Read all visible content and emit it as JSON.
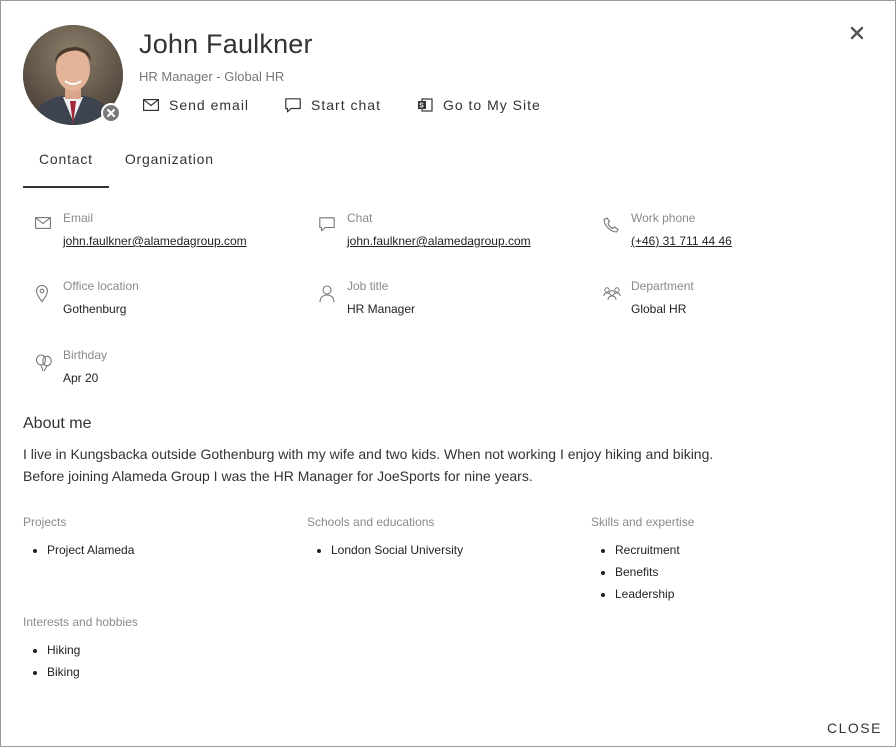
{
  "person": {
    "name": "John Faulkner",
    "subtitle": "HR Manager - Global HR"
  },
  "actions": {
    "send_email": "Send email",
    "start_chat": "Start chat",
    "my_site": "Go to My Site"
  },
  "tabs": {
    "contact": "Contact",
    "organization": "Organization"
  },
  "contact": {
    "email": {
      "label": "Email",
      "value": "john.faulkner@alamedagroup.com"
    },
    "chat": {
      "label": "Chat",
      "value": "john.faulkner@alamedagroup.com"
    },
    "work_phone": {
      "label": "Work phone",
      "value": "(+46) 31 711 44 46"
    },
    "office_location": {
      "label": "Office location",
      "value": "Gothenburg"
    },
    "job_title": {
      "label": "Job title",
      "value": "HR Manager"
    },
    "department": {
      "label": "Department",
      "value": "Global HR"
    },
    "birthday": {
      "label": "Birthday",
      "value": "Apr 20"
    }
  },
  "about": {
    "heading": "About me",
    "line1": "I live in Kungsbacka outside Gothenburg with my wife and two kids. When not working I enjoy hiking and biking.",
    "line2": "Before joining Alameda Group I was the HR Manager for JoeSports for nine years."
  },
  "sections": {
    "projects": {
      "heading": "Projects",
      "items": [
        "Project Alameda"
      ]
    },
    "schools": {
      "heading": "Schools and educations",
      "items": [
        "London Social University"
      ]
    },
    "skills": {
      "heading": "Skills and expertise",
      "items": [
        "Recruitment",
        "Benefits",
        "Leadership"
      ]
    },
    "interests": {
      "heading": "Interests and hobbies",
      "items": [
        "Hiking",
        "Biking"
      ]
    }
  },
  "footer": {
    "close": "CLOSE"
  },
  "icons": {
    "close": "close-icon",
    "presence": "presence-offline-icon",
    "email": "mail-icon",
    "chat": "chat-icon",
    "site": "sharepoint-icon",
    "phone": "phone-icon",
    "location": "location-pin-icon",
    "person": "person-icon",
    "people": "people-icon",
    "birthday": "balloon-icon"
  }
}
